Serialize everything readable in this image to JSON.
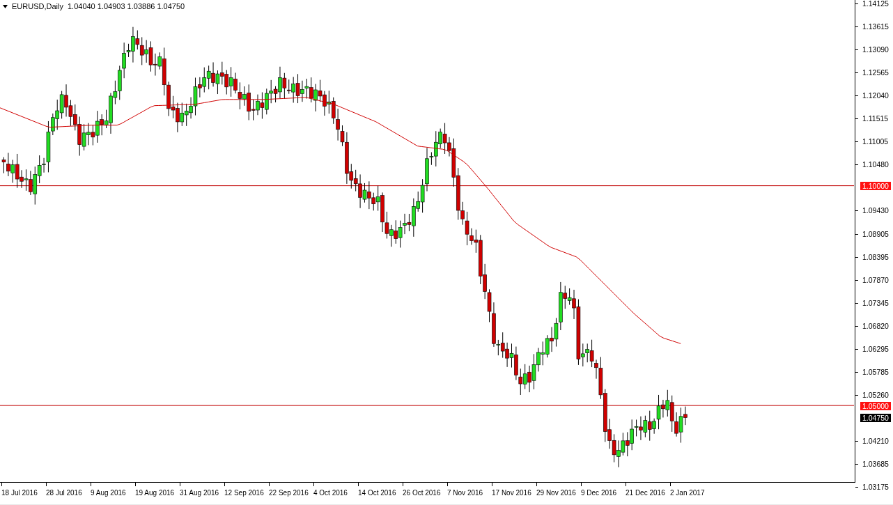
{
  "header": {
    "symbol": "EURUSD,Daily",
    "ohlc": [
      "1.04040",
      "1.04903",
      "1.03886",
      "1.04750"
    ]
  },
  "price_axis": {
    "labels": [
      "1.14125",
      "1.13615",
      "1.13090",
      "1.12565",
      "1.12040",
      "1.11515",
      "1.11005",
      "1.10480",
      "1.09430",
      "1.08905",
      "1.08395",
      "1.07870",
      "1.07345",
      "1.06820",
      "1.06295",
      "1.05785",
      "1.05260",
      "1.04210",
      "1.03685",
      "1.03175"
    ]
  },
  "levels": [
    {
      "label": "1.10000",
      "kind": "line"
    },
    {
      "label": "1.05000",
      "kind": "line"
    }
  ],
  "current_price": {
    "label": "1.04750"
  },
  "time_axis": {
    "labels": [
      "18 Jul 2016",
      "28 Jul 2016",
      "9 Aug 2016",
      "19 Aug 2016",
      "31 Aug 2016",
      "12 Sep 2016",
      "22 Sep 2016",
      "4 Oct 2016",
      "14 Oct 2016",
      "26 Oct 2016",
      "7 Nov 2016",
      "17 Nov 2016",
      "29 Nov 2016",
      "9 Dec 2016",
      "21 Dec 2016",
      "2 Jan 2017"
    ]
  }
}
